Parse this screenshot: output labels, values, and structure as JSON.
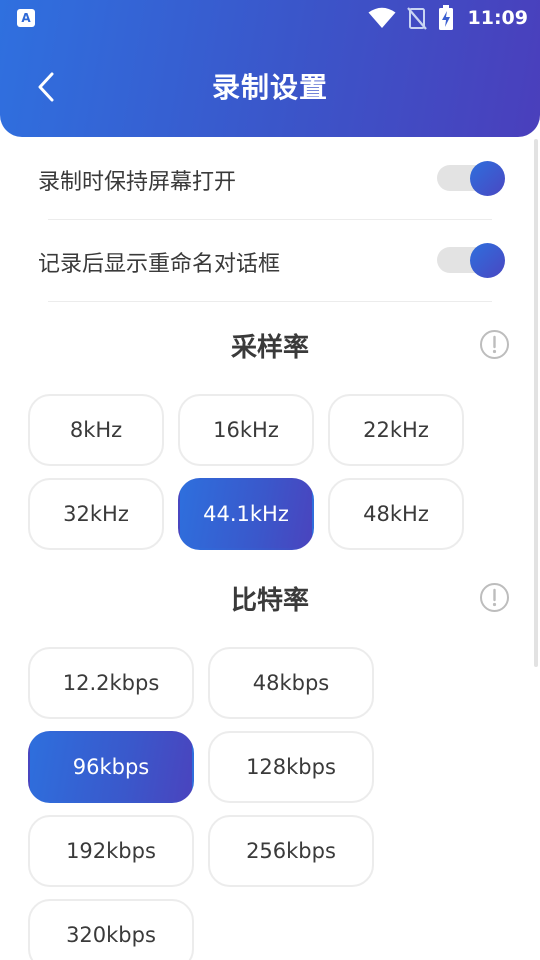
{
  "status_bar": {
    "app_icon_letter": "A",
    "time": "11:09"
  },
  "header": {
    "title": "录制设置"
  },
  "settings": {
    "keep_screen_on_label": "录制时保持屏幕打开",
    "keep_screen_on": true,
    "show_rename_dialog_label": "记录后显示重命名对话框",
    "show_rename_dialog": true
  },
  "sample_rate": {
    "title": "采样率",
    "options": [
      "8kHz",
      "16kHz",
      "22kHz",
      "32kHz",
      "44.1kHz",
      "48kHz"
    ],
    "selected": "44.1kHz"
  },
  "bit_rate": {
    "title": "比特率",
    "options": [
      "12.2kbps",
      "48kbps",
      "96kbps",
      "128kbps",
      "192kbps",
      "256kbps",
      "320kbps"
    ],
    "selected": "96kbps"
  },
  "colors": {
    "accent_start": "#2e6fdd",
    "accent_end": "#4a44be",
    "chip_border": "#ececec"
  }
}
